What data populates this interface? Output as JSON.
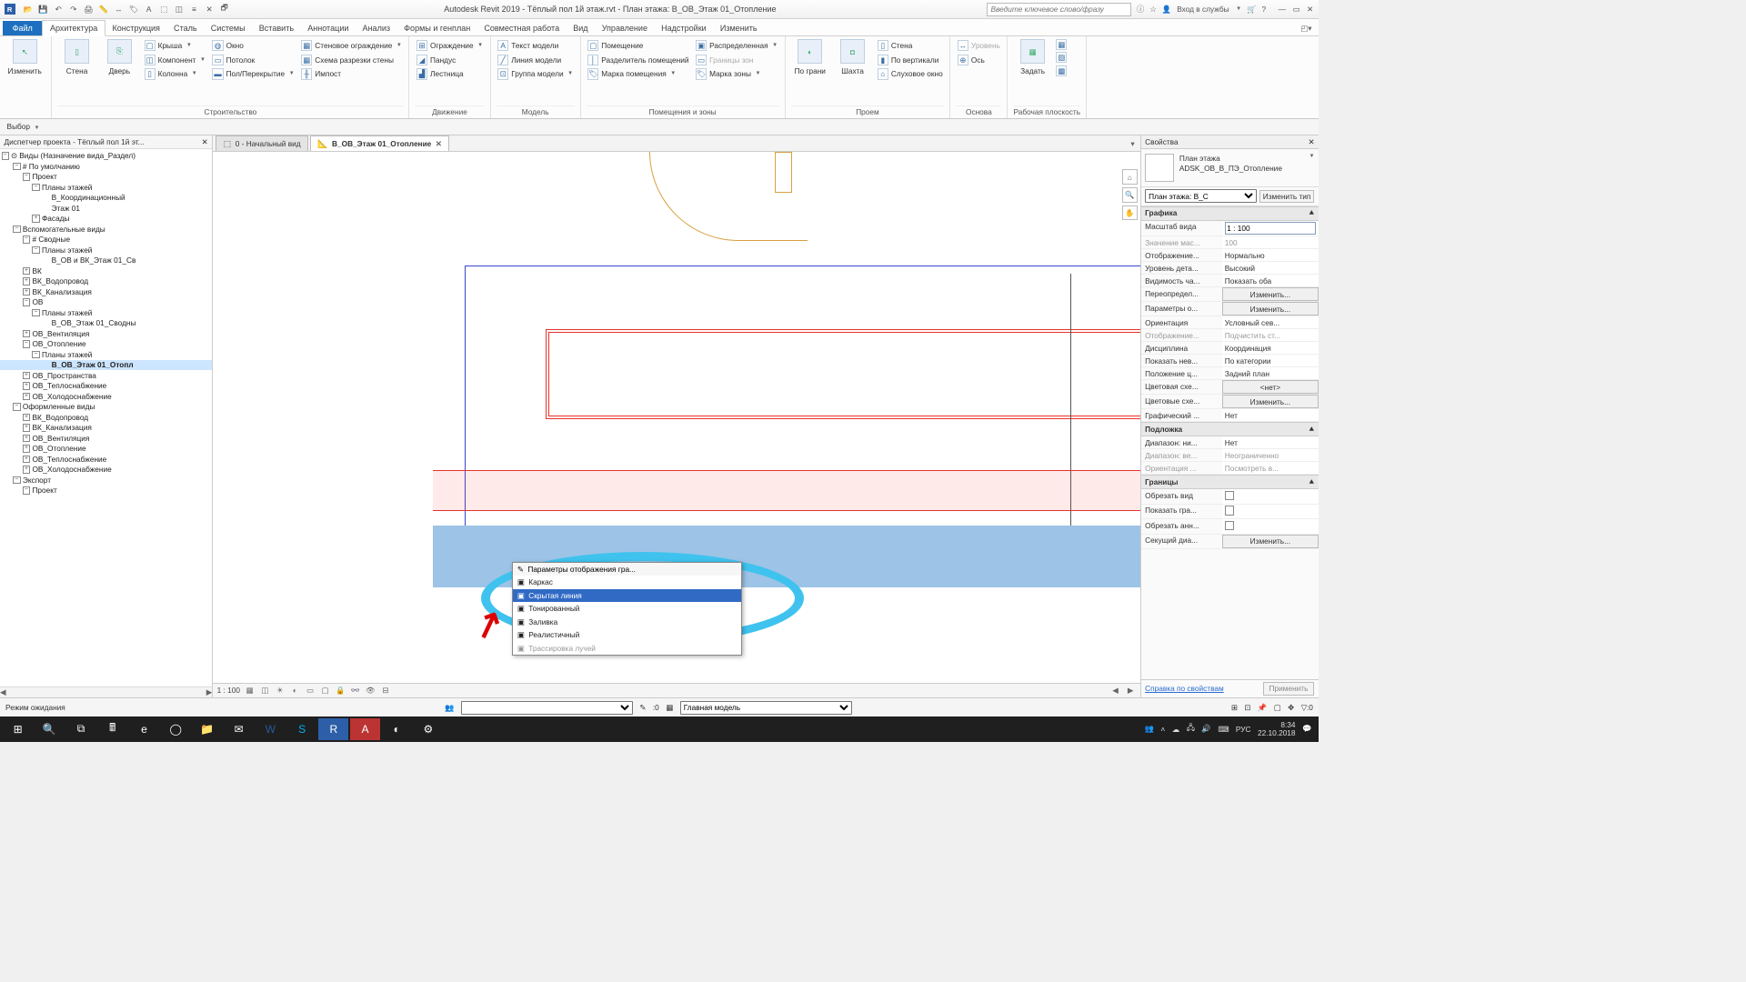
{
  "titlebar": {
    "app_title": "Autodesk Revit 2019 - Тёплый пол 1й этаж.rvt - План этажа: В_ОВ_Этаж 01_Отопление",
    "search_placeholder": "Введите ключевое слово/фразу",
    "login": "Вход в службы"
  },
  "ribbon": {
    "file": "Файл",
    "tabs": [
      "Архитектура",
      "Конструкция",
      "Сталь",
      "Системы",
      "Вставить",
      "Аннотации",
      "Анализ",
      "Формы и генплан",
      "Совместная работа",
      "Вид",
      "Управление",
      "Надстройки",
      "Изменить"
    ],
    "selector": "Выбор",
    "panels": {
      "p0_modify": "Изменить",
      "p1": {
        "title": "Строительство",
        "wall": "Стена",
        "door": "Дверь",
        "roof": "Крыша",
        "component": "Компонент",
        "column": "Колонна",
        "ceiling": "Потолок",
        "floor": "Пол/Перекрытие",
        "curtain_wall": "Стеновое ограждение",
        "curtain_grid": "Схема разрезки стены",
        "mullion": "Импост"
      },
      "p2": {
        "title": "Движение",
        "railing": "Ограждение",
        "ramp": "Пандус",
        "stair": "Лестница"
      },
      "p3": {
        "title": "Модель",
        "model_text": "Текст модели",
        "model_line": "Линия  модели",
        "model_group": "Группа модели"
      },
      "p4": {
        "title": "Помещения и зоны",
        "room": "Помещение",
        "room_sep": "Разделитель помещений",
        "room_tag": "Марка помещения",
        "area": "Распределенная",
        "area_bound": "Границы  зон",
        "area_tag": "Марка  зоны"
      },
      "p5": {
        "title": "Проем",
        "by_face": "По грани",
        "shaft": "Шахта",
        "wall2": "Стена",
        "vertical": "По вертикали",
        "dormer": "Слуховое окно"
      },
      "p6": {
        "title": "Основа",
        "level": "Уровень",
        "grid": "Ось"
      },
      "p7": {
        "title": "Рабочая плоскость",
        "set": "Задать"
      }
    }
  },
  "browser": {
    "title": "Диспетчер проекта - Тёплый пол 1й эт...",
    "root": "Виды (Назначение вида_Раздел)",
    "nodes": {
      "default": "# По умолчанию",
      "project": "Проект",
      "floor_plans": "Планы этажей",
      "coord": "В_Координационный",
      "floor01": "Этаж 01",
      "facades": "Фасады",
      "aux": "Вспомогательные виды",
      "summary": "# Сводные",
      "floor_plans2": "Планы этажей",
      "ov_vk": "В_ОВ и ВК_Этаж 01_Св",
      "vk": "ВК",
      "vk_water": "ВК_Водопровод",
      "vk_sewer": "ВК_Канализация",
      "ov": "ОВ",
      "ov_plans": "Планы этажей",
      "ov_floor01": "В_ОВ_Этаж 01_Сводны",
      "ov_vent": "ОВ_Вентиляция",
      "ov_heat": "ОВ_Отопление",
      "ov_heat_plans": "Планы этажей",
      "ov_heat_view": "В_ОВ_Этаж 01_Отопл",
      "ov_spaces": "ОВ_Пространства",
      "ov_heatsup": "ОВ_Теплоснабжение",
      "ov_cold": "ОВ_Холодоснабжение",
      "formed": "Оформленные виды",
      "f_vk_water": "ВК_Водопровод",
      "f_vk_sewer": "ВК_Канализация",
      "f_ov_vent": "ОВ_Вентиляция",
      "f_ov_heat": "ОВ_Отопление",
      "f_ov_heatsup": "ОВ_Теплоснабжение",
      "f_ov_cold": "ОВ_Холодоснабжение",
      "export": "Экспорт",
      "export_prj": "Проект"
    }
  },
  "doc_tabs": {
    "start": "0 - Начальный вид",
    "active": "В_ОВ_Этаж 01_Отопление"
  },
  "popup": {
    "header": "Параметры отображения гра...",
    "wireframe": "Каркас",
    "hidden": "Скрытая линия",
    "shaded": "Тонированный",
    "consistent": "Заливка",
    "realistic": "Реалистичный",
    "raytrace": "Трассировка лучей"
  },
  "viewbar": {
    "scale": "1 : 100"
  },
  "props": {
    "title": "Свойства",
    "type_name": "План этажа",
    "type_sub": "ADSK_ОВ_В_ПЭ_Отопление",
    "selector": "План этажа: В_С",
    "edit_type": "Изменить тип",
    "g_graphics": "Графика",
    "scale_k": "Масштаб вида",
    "scale_v": "1 : 100",
    "scale_val_k": "Значение мас...",
    "scale_val_v": "100",
    "display_k": "Отображение...",
    "display_v": "Нормально",
    "detail_k": "Уровень дета...",
    "detail_v": "Высокий",
    "vis_k": "Видимость ча...",
    "vis_v": "Показать оба",
    "override_k": "Переопредел...",
    "override_v": "Изменить...",
    "gparam_k": "Параметры о...",
    "gparam_v": "Изменить...",
    "orient_k": "Ориентация",
    "orient_v": "Условный сев...",
    "wall_join_k": "Отображение...",
    "wall_join_v": "Подчистить ст...",
    "disc_k": "Дисциплина",
    "disc_v": "Координация",
    "hidden_k": "Показать нев...",
    "hidden_v": "По категории",
    "zpos_k": "Положение ц...",
    "zpos_v": "Задний план",
    "cscheme_k": "Цветовая схе...",
    "cscheme_v": "<нет>",
    "csset_k": "Цветовые схе...",
    "csset_v": "Изменить...",
    "gstyle_k": "Графический ...",
    "gstyle_v": "Нет",
    "g_underlay": "Подложка",
    "ul_low_k": "Диапазон: ни...",
    "ul_low_v": "Нет",
    "ul_high_k": "Диапазон: ве...",
    "ul_high_v": "Неограниченно",
    "ul_orient_k": "Ориентация ...",
    "ul_orient_v": "Посмотреть в...",
    "g_extents": "Границы",
    "crop_k": "Обрезать вид",
    "cropvis_k": "Показать гра...",
    "anncrop_k": "Обрезать анн...",
    "section_k": "Секущий диа...",
    "section_v": "Изменить...",
    "help": "Справка по свойствам",
    "apply": "Применить"
  },
  "statusbar": {
    "mode": "Режим ожидания",
    "zero": ":0",
    "model": "Главная модель"
  },
  "taskbar": {
    "lang": "РУС",
    "time": "8:34",
    "date": "22.10.2018"
  }
}
